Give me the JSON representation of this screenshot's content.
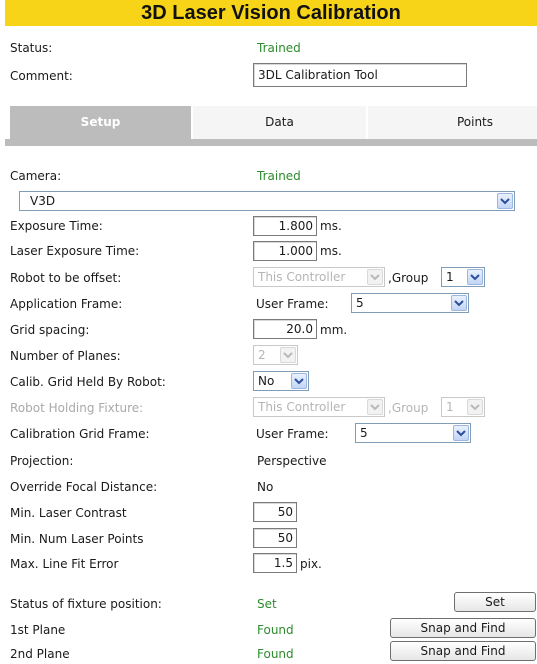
{
  "title": "3D Laser Vision Calibration",
  "status": {
    "label": "Status:",
    "value": "Trained"
  },
  "comment": {
    "label": "Comment:",
    "value": "3DL Calibration Tool"
  },
  "tabs": [
    {
      "label": "Setup",
      "active": true
    },
    {
      "label": "Data",
      "active": false
    },
    {
      "label": "Points",
      "active": false
    }
  ],
  "camera": {
    "label": "Camera:",
    "status": "Trained",
    "selected": "V3D"
  },
  "exposure_time": {
    "label": "Exposure Time:",
    "value": "1.800",
    "unit": "ms."
  },
  "laser_exposure_time": {
    "label": "Laser Exposure Time:",
    "value": "1.000",
    "unit": "ms."
  },
  "robot_offset": {
    "label": "Robot to be offset:",
    "controller": "This Controller",
    "group_label": ",Group",
    "group": "1"
  },
  "application_frame": {
    "label": "Application Frame:",
    "frame_label": "User Frame:",
    "frame": "5"
  },
  "grid_spacing": {
    "label": "Grid spacing:",
    "value": "20.0",
    "unit": "mm."
  },
  "number_of_planes": {
    "label": "Number of Planes:",
    "value": "2"
  },
  "calib_grid_held": {
    "label": "Calib. Grid Held By Robot:",
    "value": "No"
  },
  "robot_holding_fixture": {
    "label": "Robot Holding Fixture:",
    "controller": "This Controller",
    "group_label": ",Group",
    "group": "1"
  },
  "calibration_grid_frame": {
    "label": "Calibration Grid Frame:",
    "frame_label": "User Frame:",
    "frame": "5"
  },
  "projection": {
    "label": "Projection:",
    "value": "Perspective"
  },
  "override_focal": {
    "label": "Override Focal Distance:",
    "value": "No"
  },
  "min_laser_contrast": {
    "label": "Min. Laser Contrast",
    "value": "50"
  },
  "min_num_laser_points": {
    "label": "Min. Num Laser Points",
    "value": "50"
  },
  "max_line_fit_error": {
    "label": "Max. Line Fit Error",
    "value": "1.5",
    "unit": "pix."
  },
  "fixture_status": {
    "label": "Status of fixture position:",
    "value": "Set",
    "button": "Set"
  },
  "plane1": {
    "label": "1st Plane",
    "value": "Found",
    "button": "Snap and Find"
  },
  "plane2": {
    "label": "2nd Plane",
    "value": "Found",
    "button": "Snap and Find"
  },
  "colors": {
    "title_bg": "#f7d418",
    "status_green": "#2e8b2e",
    "tab_active": "#bcbcbc",
    "disabled_text": "#a9a9a9"
  }
}
